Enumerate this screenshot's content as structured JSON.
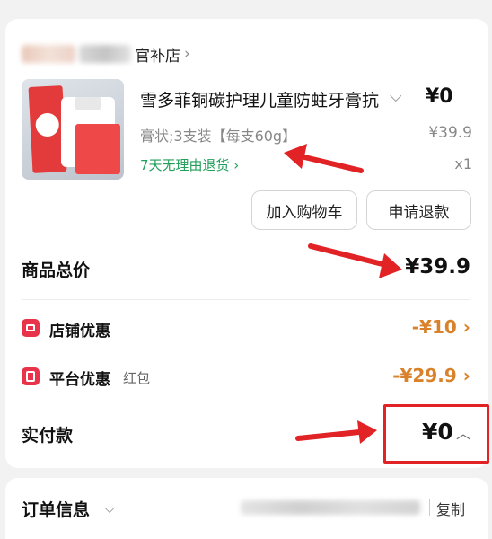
{
  "shop": {
    "name_suffix": "官补店",
    "chevron": "›"
  },
  "product": {
    "title": "雪多菲铜碳护理儿童防蛀牙膏抗",
    "price": "¥0",
    "spec": "膏状;3支装【每支60g】",
    "original_price": "¥39.9",
    "returns_policy": "7天无理由退货 ›",
    "quantity": "x1",
    "image_icon": "toothpaste-product-image"
  },
  "actions": {
    "add_to_cart": "加入购物车",
    "refund": "申请退款"
  },
  "summary": {
    "total_label": "商品总价",
    "total_value": "¥39.9",
    "store_discount_label": "店铺优惠",
    "store_discount_value": "-¥10 ›",
    "platform_discount_label": "平台优惠",
    "platform_discount_sub": "红包",
    "platform_discount_value": "-¥29.9 ›",
    "paid_label": "实付款",
    "paid_value": "¥0"
  },
  "order_info": {
    "label": "订单信息",
    "copy": "复制"
  },
  "colors": {
    "annotation_red": "#e22326",
    "discount_orange": "#d9822b",
    "return_green": "#22a05b",
    "icon_red": "#e8334a"
  }
}
